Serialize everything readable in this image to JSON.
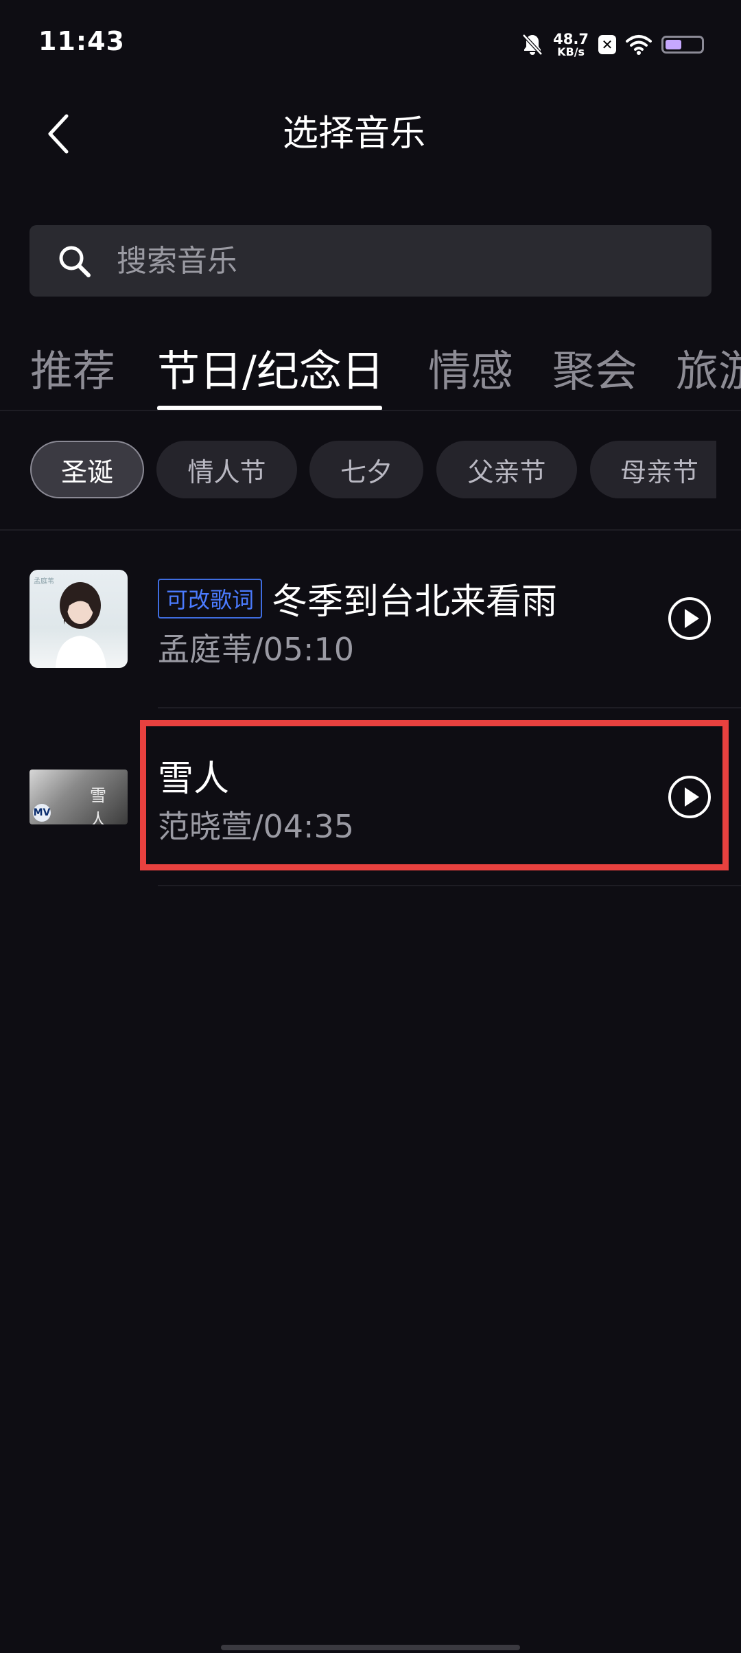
{
  "status_bar": {
    "time": "11:43",
    "net_speed_value": "48.7",
    "net_speed_unit": "KB/s",
    "sim_label": "✕",
    "battery_level": 0.45,
    "icons": [
      "bell-off-icon",
      "sim-x-icon",
      "wifi-icon",
      "battery-icon"
    ]
  },
  "header": {
    "title": "选择音乐",
    "back_icon": "chevron-left-icon"
  },
  "search": {
    "placeholder": "搜索音乐",
    "icon": "search-icon"
  },
  "tabs": [
    {
      "label": "推荐",
      "active": false
    },
    {
      "label": "节日/纪念日",
      "active": true
    },
    {
      "label": "情感",
      "active": false
    },
    {
      "label": "聚会",
      "active": false
    },
    {
      "label": "旅游",
      "active": false
    }
  ],
  "chips": [
    {
      "label": "圣诞",
      "active": true
    },
    {
      "label": "情人节",
      "active": false
    },
    {
      "label": "七夕",
      "active": false
    },
    {
      "label": "父亲节",
      "active": false
    },
    {
      "label": "母亲节",
      "active": false
    }
  ],
  "songs": [
    {
      "badge": "可改歌词",
      "title": "冬季到台北来看雨",
      "artist": "孟庭苇",
      "duration": "05:10",
      "meta": "孟庭苇/05:10",
      "cover_text": "孟庭苇"
    },
    {
      "badge": "",
      "title": "雪人",
      "artist": "范晓萱",
      "duration": "04:35",
      "meta": "范晓萱/04:35",
      "cover_text": "雪 人",
      "cover_badge": "MV"
    }
  ],
  "colors": {
    "background": "#0e0d13",
    "search_bg": "#2a2a30",
    "badge_blue": "#4b7bff",
    "highlight_red": "#e8413f",
    "battery_purple": "#c6a8ff"
  }
}
